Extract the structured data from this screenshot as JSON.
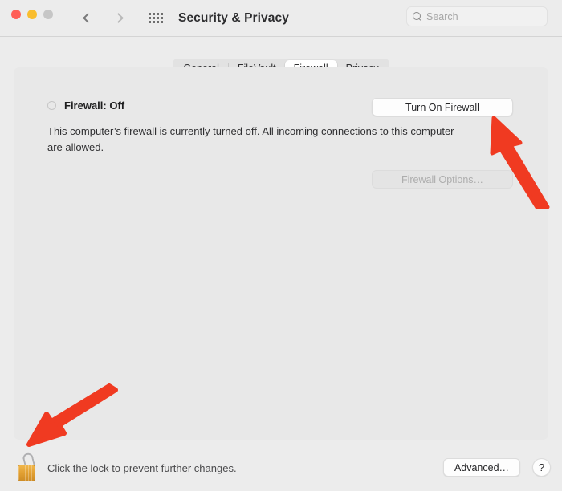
{
  "window": {
    "title": "Security & Privacy",
    "traffic_lights": [
      {
        "name": "close",
        "color": "#ff5f57"
      },
      {
        "name": "minimize",
        "color": "#f9bd2e"
      },
      {
        "name": "zoom",
        "color": "#c6c6c6"
      }
    ]
  },
  "toolbar": {
    "back_icon": "chevron-left-icon",
    "forward_icon": "chevron-right-icon",
    "grid_icon": "grid-dots-icon",
    "search": {
      "icon": "search-icon",
      "placeholder": "Search",
      "value": ""
    }
  },
  "tabs": [
    {
      "label": "General",
      "selected": false
    },
    {
      "label": "FileVault",
      "selected": false
    },
    {
      "label": "Firewall",
      "selected": true
    },
    {
      "label": "Privacy",
      "selected": false
    }
  ],
  "firewall": {
    "status_label": "Firewall: Off",
    "status_state": "off",
    "description": "This computer’s firewall is currently turned off. All incoming connections to this computer are allowed.",
    "turn_on_button": "Turn On Firewall",
    "options_button": "Firewall Options…",
    "options_button_disabled": true
  },
  "footer": {
    "lock_icon": "padlock-open-icon",
    "lock_text": "Click the lock to prevent further changes.",
    "advanced_button": "Advanced…",
    "help_button": "?"
  },
  "annotations": {
    "accent_color": "#f03a21",
    "arrows": [
      {
        "name": "arrow-to-turn-on-firewall",
        "points_to": "Turn On Firewall"
      },
      {
        "name": "arrow-to-lock",
        "points_to": "padlock"
      }
    ]
  }
}
